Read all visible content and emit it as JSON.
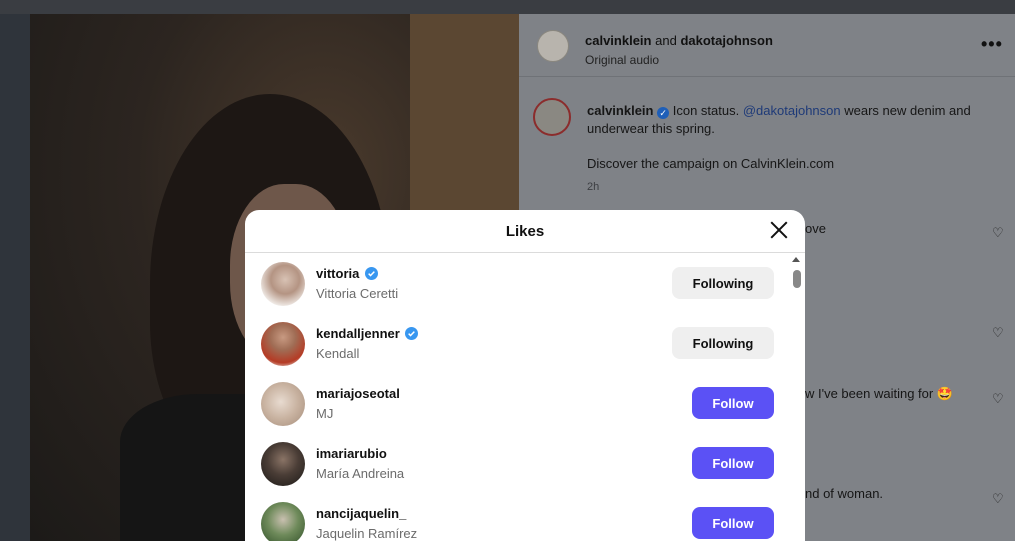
{
  "post": {
    "header_user1": "calvinklein",
    "header_and": "and",
    "header_user2": "dakotajohnson",
    "audio": "Original audio",
    "more_icon": "•••",
    "caption_user": "calvinklein",
    "caption_text_a": "Icon status.",
    "caption_mention": "@dakotajohnson",
    "caption_text_b": "wears new denim and underwear this spring.",
    "caption_line2": "Discover the campaign on CalvinKlein.com",
    "caption_time": "2h",
    "comments": [
      {
        "text": "ove"
      },
      {
        "text": "w I've been waiting for 🤩"
      },
      {
        "text": "nd of woman."
      }
    ],
    "verified_glyph": "✓"
  },
  "likes_modal": {
    "title": "Likes",
    "users": [
      {
        "username": "vittoria",
        "verified": true,
        "fullname": "Vittoria Ceretti",
        "button": "Following",
        "state": "following"
      },
      {
        "username": "kendalljenner",
        "verified": true,
        "fullname": "Kendall",
        "button": "Following",
        "state": "following"
      },
      {
        "username": "mariajoseotal",
        "verified": false,
        "fullname": "MJ",
        "button": "Follow",
        "state": "follow"
      },
      {
        "username": "imariarubio",
        "verified": false,
        "fullname": "María Andreina",
        "button": "Follow",
        "state": "follow"
      },
      {
        "username": "nancijaquelin_",
        "verified": false,
        "fullname": "Jaquelin Ramírez",
        "button": "Follow",
        "state": "follow"
      }
    ]
  },
  "colors": {
    "follow_button": "#5b51f5",
    "following_button": "#efefef",
    "verified": "#1f5fb8"
  }
}
